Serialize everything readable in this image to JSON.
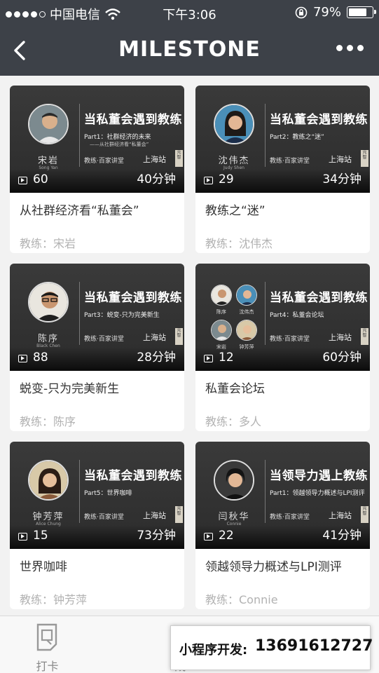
{
  "status_bar": {
    "carrier": "中国电信",
    "time": "下午3:06",
    "battery": "79%",
    "battery_level": 0.79
  },
  "nav": {
    "title": "MILESTONE"
  },
  "courses": [
    {
      "banner_title": "当私董会遇到教练",
      "part": "Part1：社群经济的未来",
      "sub": "——从社群经济看“私董会”",
      "speaker": "宋岩",
      "speaker_en": "Song Yan",
      "count": "60",
      "duration": "40分钟",
      "title": "从社群经济看“私董会”",
      "teacher": "教练：宋岩"
    },
    {
      "banner_title": "当私董会遇到教练",
      "part": "Part2：教练之“迷”",
      "speaker": "沈伟杰",
      "speaker_en": "Judy Shen",
      "count": "29",
      "duration": "34分钟",
      "title": "教练之“迷”",
      "teacher": "教练：沈伟杰"
    },
    {
      "banner_title": "当私董会遇到教练",
      "part": "Part3：蜕变-只为完美新生",
      "speaker": "陈序",
      "speaker_en": "Black Chen",
      "count": "88",
      "duration": "28分钟",
      "title": "蜕变-只为完美新生",
      "teacher": "教练：陈序"
    },
    {
      "banner_title": "当私董会遇到教练",
      "part": "Part4：私董会论坛",
      "speakers": [
        "陈序",
        "沈伟杰",
        "宋岩",
        "钟芳萍"
      ],
      "count": "12",
      "duration": "60分钟",
      "title": "私董会论坛",
      "teacher": "教练：多人"
    },
    {
      "banner_title": "当私董会遇到教练",
      "part": "Part5：世界咖啡",
      "speaker": "钟芳萍",
      "speaker_en": "Alice Chung",
      "count": "15",
      "duration": "73分钟",
      "title": "世界咖啡",
      "teacher": "教练：钟芳萍"
    },
    {
      "banner_title": "当领导力遇上教练",
      "part": "Part1：领越领导力概述与LPI测评",
      "speaker": "闫秋华",
      "speaker_en": "Connie",
      "count": "22",
      "duration": "41分钟",
      "title": "领越领导力概述与LPI测评",
      "teacher": "教练：Connie"
    }
  ],
  "banner_logos": {
    "left": "教练·百家讲堂",
    "right": "上海站",
    "stamp": "元智"
  },
  "tabs": [
    {
      "label": "打卡",
      "icon": "checkin-icon"
    },
    {
      "label": "成",
      "icon": "growth-icon"
    },
    {
      "label": "",
      "icon": "tab3-icon"
    },
    {
      "label": "",
      "icon": "tab4-icon"
    }
  ],
  "overlay": {
    "label": "小程序开发:",
    "phone": "13691612727"
  }
}
